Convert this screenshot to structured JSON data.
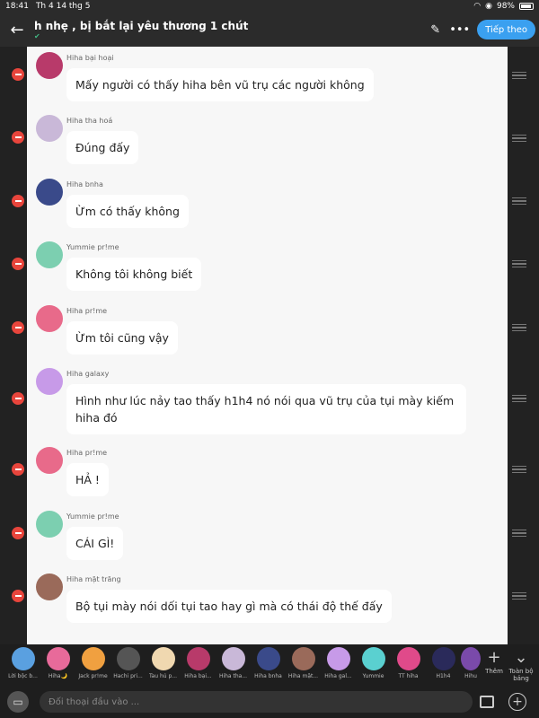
{
  "status": {
    "time": "18:41",
    "date": "Th 4 14 thg 5",
    "battery": "98%"
  },
  "header": {
    "title": "h nhẹ , bị bắt lại yêu thương 1 chút",
    "subtitle": "",
    "next_label": "Tiếp theo"
  },
  "messages": [
    {
      "name": "Hiha bại hoại",
      "text": "Mấy người có thấy hiha bên vũ trụ các người không",
      "avatar_color": "#b83a6a"
    },
    {
      "name": "Hiha tha hoá",
      "text": "Đúng đấy",
      "avatar_color": "#c9b8d8"
    },
    {
      "name": "Hiha bnha",
      "text": "Ừm có thấy không",
      "avatar_color": "#3a4a8a"
    },
    {
      "name": "Yummie pr!me",
      "text": "Không tôi không biết",
      "avatar_color": "#7ccfb0"
    },
    {
      "name": "Hiha pr!me",
      "text": "Ừm tôi cũng vậy",
      "avatar_color": "#e86a8a"
    },
    {
      "name": "Hiha galaxy",
      "text": "Hình như lúc nảy tao thấy h1h4 nó nói qua vũ trụ của tụi mày kiếm hiha đó",
      "avatar_color": "#c79ae8"
    },
    {
      "name": "Hiha pr!me",
      "text": "HẢ !",
      "avatar_color": "#e86a8a"
    },
    {
      "name": "Yummie pr!me",
      "text": "CÁI GÌ!",
      "avatar_color": "#7ccfb0"
    },
    {
      "name": "Hiha mặt trăng",
      "text": "Bộ tụi mày nói dối tụi tao hay gì mà có  thái độ thế đấy",
      "avatar_color": "#9a6a5a"
    }
  ],
  "members": [
    {
      "label": "Lời bộc b...",
      "color": "#5aa0e0"
    },
    {
      "label": "Hiha🌙",
      "color": "#e86a9a"
    },
    {
      "label": "Jack pr!me",
      "color": "#f0a040"
    },
    {
      "label": "Hachi pri...",
      "color": "#555555"
    },
    {
      "label": "Tau hủ p...",
      "color": "#f0d8b0"
    },
    {
      "label": "Hiha bại...",
      "color": "#b83a6a"
    },
    {
      "label": "Hiha tha...",
      "color": "#c9b8d8"
    },
    {
      "label": "Hiha bnha",
      "color": "#3a4a8a"
    },
    {
      "label": "Hiha mặt...",
      "color": "#9a6a5a"
    },
    {
      "label": "Hiha gal...",
      "color": "#c79ae8"
    },
    {
      "label": "Yummie",
      "color": "#5ad0d0"
    },
    {
      "label": "TT hiha",
      "color": "#e04a8a"
    },
    {
      "label": "H1h4",
      "color": "#2a2a5a"
    },
    {
      "label": "Hihu",
      "color": "#7a4aaa"
    }
  ],
  "actions": {
    "add_label": "Thêm",
    "all_label": "Toàn bộ bảng"
  },
  "input": {
    "placeholder": "Đối thoại đầu vào ..."
  }
}
